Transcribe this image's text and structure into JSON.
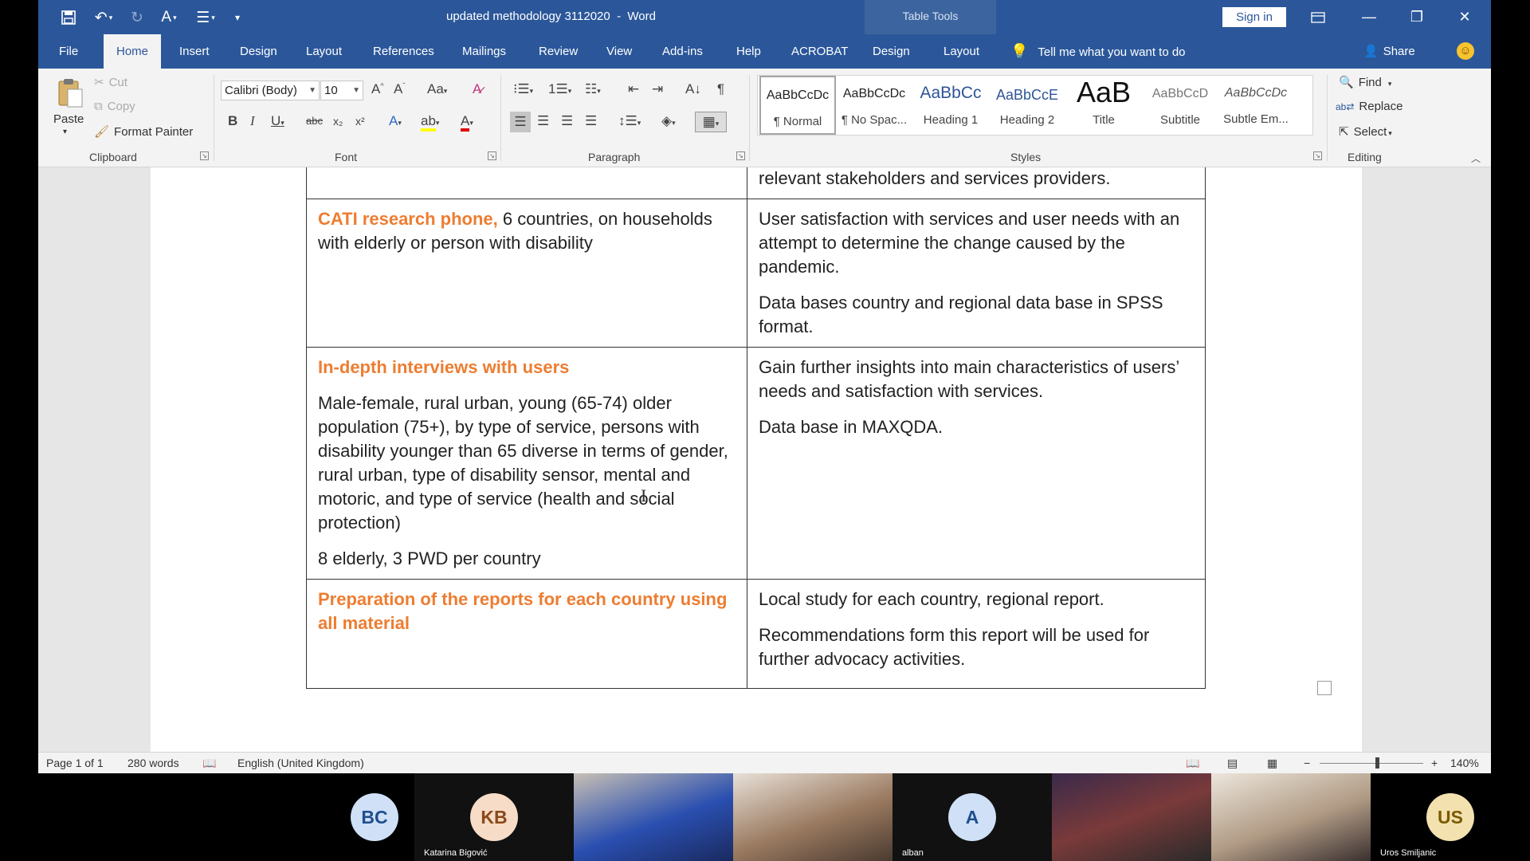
{
  "window": {
    "title": "updated methodology 3112020  -  Word",
    "contextual_label": "Table Tools",
    "sign_in": "Sign in"
  },
  "tabs": [
    {
      "label": "File"
    },
    {
      "label": "Home"
    },
    {
      "label": "Insert"
    },
    {
      "label": "Design"
    },
    {
      "label": "Layout"
    },
    {
      "label": "References"
    },
    {
      "label": "Mailings"
    },
    {
      "label": "Review"
    },
    {
      "label": "View"
    },
    {
      "label": "Add-ins"
    },
    {
      "label": "Help"
    },
    {
      "label": "ACROBAT"
    },
    {
      "label": "Design"
    },
    {
      "label": "Layout"
    }
  ],
  "tell_me": "Tell me what you want to do",
  "share": "Share",
  "ribbon": {
    "clipboard": {
      "label": "Clipboard",
      "paste": "Paste",
      "cut": "Cut",
      "copy": "Copy",
      "format_painter": "Format Painter"
    },
    "font": {
      "label": "Font",
      "font_name": "Calibri (Body)",
      "font_size": "10"
    },
    "paragraph": {
      "label": "Paragraph"
    },
    "styles": {
      "label": "Styles",
      "items": [
        {
          "sample": "AaBbCcDc",
          "name": "¶ Normal"
        },
        {
          "sample": "AaBbCcDc",
          "name": "¶ No Spac..."
        },
        {
          "sample": "AaBbCc",
          "name": "Heading 1"
        },
        {
          "sample": "AaBbCcE",
          "name": "Heading 2"
        },
        {
          "sample": "AaB",
          "name": "Title"
        },
        {
          "sample": "AaBbCcD",
          "name": "Subtitle"
        },
        {
          "sample": "AaBbCcDc",
          "name": "Subtle Em..."
        }
      ]
    },
    "editing": {
      "label": "Editing",
      "find": "Find",
      "replace": "Replace",
      "select": "Select"
    }
  },
  "document": {
    "top_fragment": "relevant stakeholders and services providers.",
    "rows": [
      {
        "left_heading": "CATI research phone,",
        "left_text": " 6 countries, on households with elderly or person with disability",
        "right_paras": [
          "User satisfaction with services and user needs with an attempt to determine the change caused by the pandemic.",
          "Data bases country and regional data base in SPSS format."
        ]
      },
      {
        "left_heading": "In-depth interviews with users",
        "left_paras": [
          "Male-female, rural urban, young (65-74) older population (75+), by type of service, persons with disability younger than 65 diverse in terms of gender, rural urban, type of disability sensor, mental and motoric, and type of service (health and social protection)",
          "8 elderly, 3 PWD per country"
        ],
        "right_paras": [
          "Gain further insights into main characteristics of users’ needs and satisfaction with services.",
          "Data base in MAXQDA."
        ]
      },
      {
        "left_heading": "Preparation of the reports for each country using all material",
        "right_paras": [
          "Local study for each country, regional report.",
          "Recommendations form this report will be used for further advocacy activities."
        ]
      }
    ]
  },
  "status": {
    "page": "Page 1 of 1",
    "words": "280 words",
    "language": "English (United Kingdom)",
    "zoom": "140%"
  },
  "participants": [
    {
      "initials": "BC",
      "name": "",
      "color": "#cfe0f7",
      "text_color": "#1f4e8c"
    },
    {
      "initials": "KB",
      "name": "Katarina Bigović",
      "color": "#f7dcc8",
      "text_color": "#8a4a1a"
    },
    {
      "initials": "",
      "name": "",
      "color": "#3a4a6a"
    },
    {
      "initials": "",
      "name": "",
      "color": "#5a4a40"
    },
    {
      "initials": "A",
      "name": "alban",
      "color": "#cfe0f7",
      "text_color": "#1f4e8c"
    },
    {
      "initials": "",
      "name": "",
      "color": "#3a2a3a"
    },
    {
      "initials": "",
      "name": "",
      "color": "#7a6a5a"
    },
    {
      "initials": "US",
      "name": "Uros Smiljanic",
      "color": "#f3e2b0",
      "text_color": "#7a5a00"
    }
  ]
}
